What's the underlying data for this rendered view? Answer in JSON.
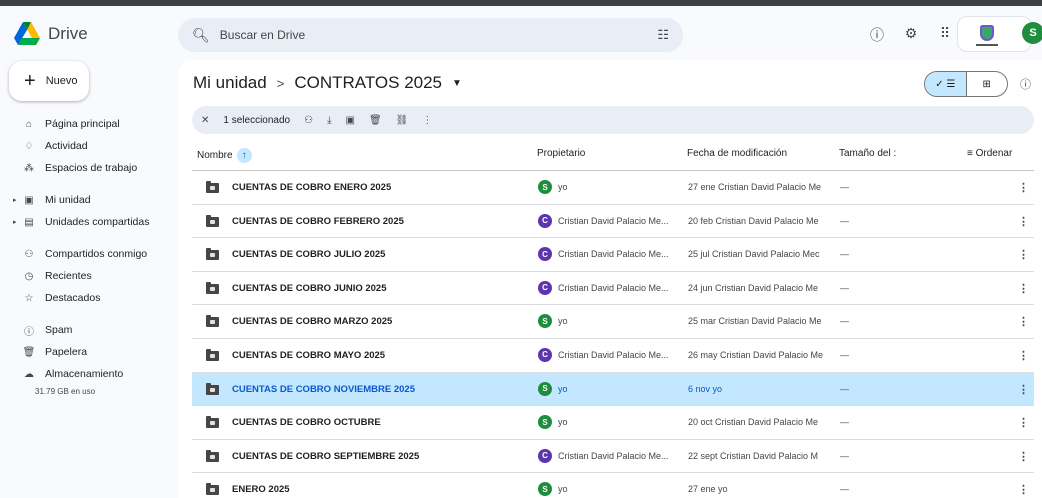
{
  "app": {
    "name": "Drive"
  },
  "colors": {
    "accent": "#0b57d0",
    "selected_row": "#c2e7ff",
    "avatar_green": "#1e8e3e",
    "avatar_purple": "#5e35b1"
  },
  "search": {
    "placeholder": "Buscar en Drive",
    "icon": "search-icon",
    "filter_icon": "tune-icon"
  },
  "header_icons": [
    "help-icon",
    "settings-icon",
    "apps-grid-icon"
  ],
  "user": {
    "initial": "S"
  },
  "new_button": {
    "label": "Nuevo"
  },
  "sidebar": {
    "items": [
      {
        "label": "Página principal",
        "icon": "home-icon",
        "glyph": "⌂"
      },
      {
        "label": "Actividad",
        "icon": "bell-icon",
        "glyph": "♢"
      },
      {
        "label": "Espacios de trabajo",
        "icon": "workspaces-icon",
        "glyph": "⁂"
      },
      {
        "label": "Mi unidad",
        "icon": "my-drive-icon",
        "glyph": "▣",
        "expandable": true
      },
      {
        "label": "Unidades compartidas",
        "icon": "shared-drives-icon",
        "glyph": "▤",
        "expandable": true
      },
      {
        "label": "Compartidos conmigo",
        "icon": "people-icon",
        "glyph": "⚇"
      },
      {
        "label": "Recientes",
        "icon": "clock-icon",
        "glyph": "◷"
      },
      {
        "label": "Destacados",
        "icon": "star-icon",
        "glyph": "☆"
      },
      {
        "label": "Spam",
        "icon": "spam-icon",
        "glyph": "ⓘ"
      },
      {
        "label": "Papelera",
        "icon": "trash-icon",
        "glyph": "🗑"
      },
      {
        "label": "Almacenamiento",
        "icon": "cloud-icon",
        "glyph": "☁"
      }
    ],
    "storage_used": "31.79 GB en uso"
  },
  "breadcrumb": {
    "root": "Mi unidad",
    "separator": ">",
    "current": "CONTRATOS 2025"
  },
  "selection_bar": {
    "count_label": "1 seleccionado"
  },
  "table": {
    "headers": {
      "name": "Nombre",
      "owner": "Propietario",
      "modified": "Fecha de modificación",
      "size": "Tamaño del :",
      "sort": "Ordenar"
    },
    "rows": [
      {
        "name": "CUENTAS DE COBRO ENERO 2025",
        "owner_initial": "S",
        "owner": "yo",
        "modified": "27 ene Cristian David Palacio Me",
        "size": "—",
        "selected": false
      },
      {
        "name": "CUENTAS DE COBRO FEBRERO 2025",
        "owner_initial": "C",
        "owner": "Cristian David Palacio Me...",
        "modified": "20 feb Cristian David Palacio Me",
        "size": "—",
        "selected": false
      },
      {
        "name": "CUENTAS DE COBRO JULIO 2025",
        "owner_initial": "C",
        "owner": "Cristian David Palacio Me...",
        "modified": "25 jul Cristian David Palacio Mec",
        "size": "—",
        "selected": false
      },
      {
        "name": "CUENTAS DE COBRO JUNIO 2025",
        "owner_initial": "C",
        "owner": "Cristian David Palacio Me...",
        "modified": "24 jun Cristian David Palacio Me",
        "size": "—",
        "selected": false
      },
      {
        "name": "CUENTAS DE COBRO MARZO 2025",
        "owner_initial": "S",
        "owner": "yo",
        "modified": "25 mar Cristian David Palacio Me",
        "size": "—",
        "selected": false
      },
      {
        "name": "CUENTAS DE COBRO MAYO 2025",
        "owner_initial": "C",
        "owner": "Cristian David Palacio Me...",
        "modified": "26 may Cristian David Palacio Me",
        "size": "—",
        "selected": false
      },
      {
        "name": "CUENTAS DE COBRO NOVIEMBRE 2025",
        "owner_initial": "S",
        "owner": "yo",
        "modified": "6 nov yo",
        "size": "—",
        "selected": true
      },
      {
        "name": "CUENTAS DE COBRO OCTUBRE",
        "owner_initial": "S",
        "owner": "yo",
        "modified": "20 oct Cristian David Palacio Me",
        "size": "—",
        "selected": false
      },
      {
        "name": "CUENTAS DE COBRO SEPTIEMBRE 2025",
        "owner_initial": "C",
        "owner": "Cristian David Palacio Me...",
        "modified": "22 sept Cristian David Palacio M",
        "size": "—",
        "selected": false
      },
      {
        "name": "ENERO 2025",
        "owner_initial": "S",
        "owner": "yo",
        "modified": "27 ene yo",
        "size": "—",
        "selected": false
      }
    ]
  }
}
